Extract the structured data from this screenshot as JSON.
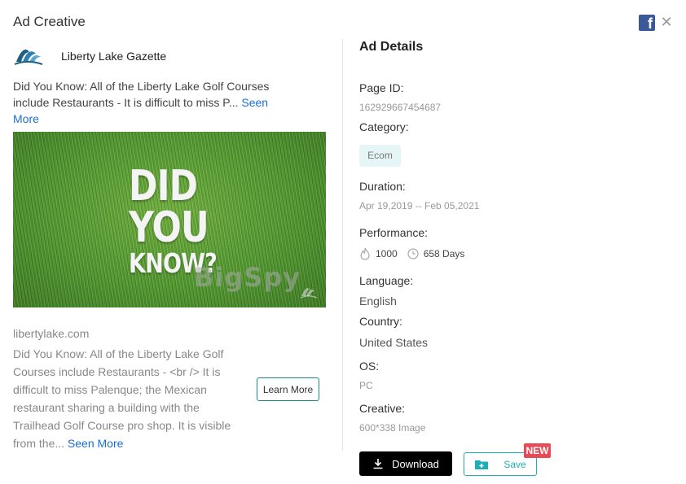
{
  "modal": {
    "title": "Ad Creative"
  },
  "advertiser": {
    "name": "Liberty Lake Gazette"
  },
  "ad": {
    "primary_text": "Did You Know: All of the Liberty Lake Golf Courses include Restaurants - It is difficult to miss P...",
    "see_more": "Seen More",
    "image_text": {
      "line1": "DID",
      "line2": "YOU",
      "line3": "KNOW?"
    },
    "watermark": "BigSpy",
    "domain": "libertylake.com",
    "description": "Did You Know: All of the Liberty Lake Golf Courses include Restaurants - <br /> It is difficult to miss Palenque; the Mexican restaurant sharing a building with the Trailhead Golf Course pro shop. It is visible from the...",
    "description_see_more": "Seen More",
    "cta": "Learn More"
  },
  "details": {
    "title": "Ad Details",
    "page_id_label": "Page ID:",
    "page_id": "162929667454687",
    "category_label": "Category:",
    "category": "Ecom",
    "duration_label": "Duration:",
    "duration": "Apr 19,2019 -- Feb 05,2021",
    "performance_label": "Performance:",
    "likes": "1000",
    "days": "658 Days",
    "language_label": "Language:",
    "language": "English",
    "country_label": "Country:",
    "country": "United States",
    "os_label": "OS:",
    "os": "PC",
    "creative_label": "Creative:",
    "creative": "600*338 Image"
  },
  "actions": {
    "download": "Download",
    "save": "Save",
    "new_badge": "NEW"
  },
  "colors": {
    "accent": "#1cafb7",
    "link": "#1a6fd4",
    "badge": "#e84b55",
    "facebook": "#3b5998",
    "tag_bg": "#e6f6f6"
  }
}
